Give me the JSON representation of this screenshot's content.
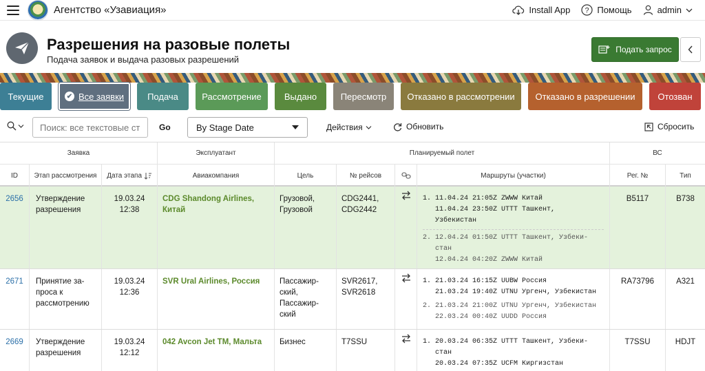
{
  "app": {
    "title": "Агентство «Узавиация»"
  },
  "nav": {
    "install": "Install App",
    "help": "Помощь",
    "user": "admin"
  },
  "header": {
    "title": "Разрешения на разовые полеты",
    "subtitle": "Подача заявок и выдача разовых разрешений",
    "submit_label": "Подать запрос"
  },
  "tabs": [
    {
      "label": "Текущие",
      "color": "#3d7f95"
    },
    {
      "label": "Все заявки",
      "color": "#5f6f7f",
      "active": true
    },
    {
      "label": "Подача",
      "color": "#4a8a86"
    },
    {
      "label": "Рассмотрение",
      "color": "#5b9a58"
    },
    {
      "label": "Выдано",
      "color": "#5a8a3e"
    },
    {
      "label": "Пересмотр",
      "color": "#8a8478"
    },
    {
      "label": "Отказано в рассмотрении",
      "color": "#8a7a3e"
    },
    {
      "label": "Отказано в разрешении",
      "color": "#b5612e"
    },
    {
      "label": "Отозван",
      "color": "#c0433a"
    }
  ],
  "toolbar": {
    "search_placeholder": "Поиск: все текстовые ст",
    "go": "Go",
    "sort_value": "By Stage Date",
    "actions": "Действия",
    "refresh": "Обновить",
    "reset": "Сбросить"
  },
  "grid": {
    "groups": {
      "request": "Заявка",
      "operator": "Эксплуатант",
      "flight": "Планируемый полет",
      "aircraft": "ВС"
    },
    "columns": {
      "id": "ID",
      "stage": "Этап рассмотрения",
      "date": "Дата этапа",
      "airline": "Авиакомпания",
      "purpose": "Цель",
      "flights": "№ рейсов",
      "routes": "Маршруты (участки)",
      "reg": "Рег. №",
      "type": "Тип"
    },
    "rows": [
      {
        "id": "2656",
        "stage": "Утверждение разрешения",
        "date": "19.03.24 12:38",
        "airline": "CDG Shandong Airlines, Китай",
        "purpose": "Грузовой, Грузовой",
        "flights": "CDG2441, CDG2442",
        "reg": "B5117",
        "type": "B738",
        "r1a": "11.04.24 21:05Z ZWWW Китай",
        "r1b": "11.04.24 23:50Z UTTT Ташкент,",
        "r1c": "Узбекистан",
        "r2a": "12.04.24 01:50Z UTTT Ташкент, Узбеки-",
        "r2b": "стан",
        "r2c": "12.04.24 04:20Z ZWWW Китай"
      },
      {
        "id": "2671",
        "stage": "Принятие за- проса к рассмотрению",
        "date": "19.03.24 12:36",
        "airline": "SVR Ural Airlines, Россия",
        "purpose": "Пассажир- ский, Пассажир- ский",
        "flights": "SVR2617, SVR2618",
        "reg": "RA73796",
        "type": "A321",
        "r1a": "21.03.24 16:15Z UUBW Россия",
        "r1b": "21.03.24 19:40Z UTNU Ургенч, Узбекистан",
        "r2a": "21.03.24 21:00Z UTNU Ургенч, Узбекистан",
        "r2b": "22.03.24 00:40Z UUDD Россия"
      },
      {
        "id": "2669",
        "stage": "Утверждение разрешения",
        "date": "19.03.24 12:12",
        "airline": "042 Avcon Jet TM, Мальта",
        "purpose": "Бизнес",
        "flights": "T7SSU",
        "reg": "T7SSU",
        "type": "HDJT",
        "r1a": "20.03.24 06:35Z UTTT Ташкент, Узбеки-",
        "r1b": "стан",
        "r1c": "20.03.24 07:35Z UCFM Киргизстан"
      }
    ]
  }
}
